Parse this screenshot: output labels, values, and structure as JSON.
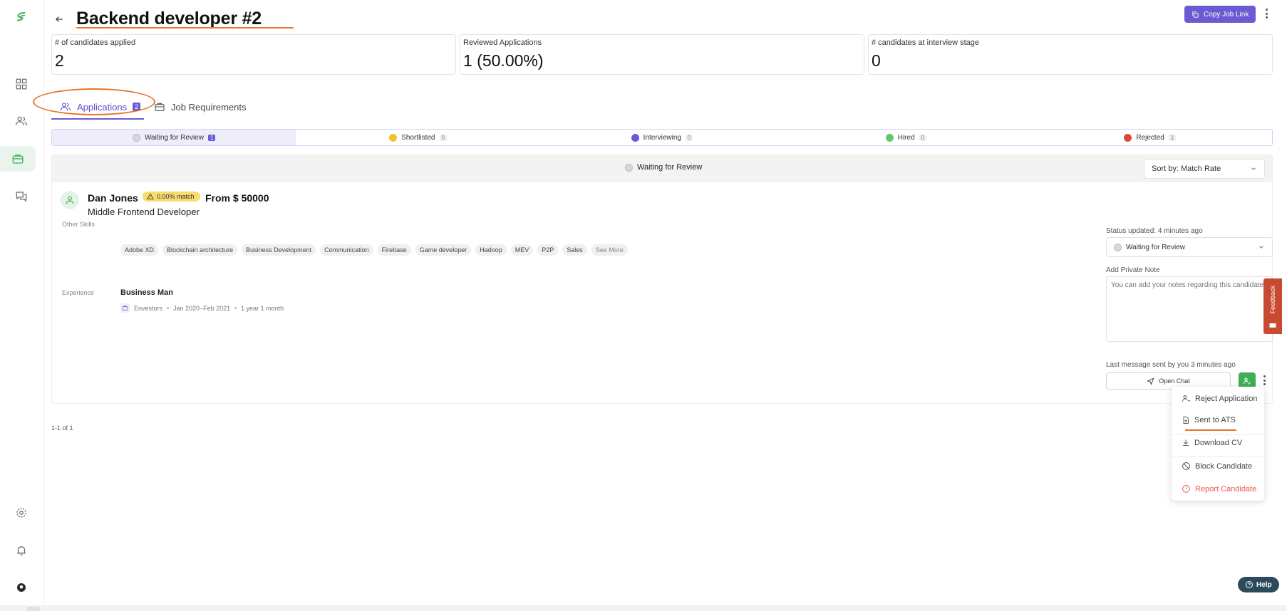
{
  "header": {
    "title": "Backend developer #2",
    "copy_link_label": "Copy Job Link"
  },
  "stats": [
    {
      "label": "# of candidates applied",
      "value": "2"
    },
    {
      "label": "Reviewed Applications",
      "value": "1 (50.00%)"
    },
    {
      "label": "# candidates at interview stage",
      "value": "0"
    }
  ],
  "tabs": [
    {
      "label": "Applications",
      "count": "2"
    },
    {
      "label": "Job Requirements"
    }
  ],
  "status_bar": [
    {
      "label": "Waiting for Review",
      "count": "1",
      "color": "#d8d8d8"
    },
    {
      "label": "Shortlisted",
      "count": "0",
      "color": "#f2c12e"
    },
    {
      "label": "Interviewing",
      "count": "0",
      "color": "#6a5bd3"
    },
    {
      "label": "Hired",
      "count": "0",
      "color": "#5fc96b"
    },
    {
      "label": "Rejected",
      "count": "1",
      "color": "#e2463b"
    }
  ],
  "panel": {
    "group_label": "Waiting for Review",
    "sort_label": "Sort by: Match Rate"
  },
  "candidate": {
    "name": "Dan Jones",
    "match": "0.00% match",
    "salary": "From $ 50000",
    "role": "Middle  Frontend Developer",
    "other_skills_label": "Other Skills",
    "skills": [
      "Adobe XD",
      "Blockchain architecture",
      "Business Development",
      "Communication",
      "Firebase",
      "Game developer",
      "Hadoop",
      "MEV",
      "P2P",
      "Sales"
    ],
    "see_more": "See More",
    "experience_label": "Experience",
    "experience": {
      "title": "Business Man",
      "company": "Envestors",
      "period": "Jan 2020–Feb 2021",
      "duration": "1 year 1 month"
    },
    "status_updated": "Status updated: 4 minutes ago",
    "status_value": "Waiting for Review",
    "note_label": "Add Private Note",
    "note_placeholder": "You can add your notes regarding this candidate",
    "last_message": "Last message sent by you 3 minutes ago",
    "open_chat": "Open Chat"
  },
  "pager": "1-1 of 1",
  "menu": {
    "items": [
      "Reject Application",
      "Sent to ATS",
      "Download CV",
      "Block Candidate",
      "Report Candidate"
    ]
  },
  "feedback_label": "Feedback",
  "help_label": "Help"
}
